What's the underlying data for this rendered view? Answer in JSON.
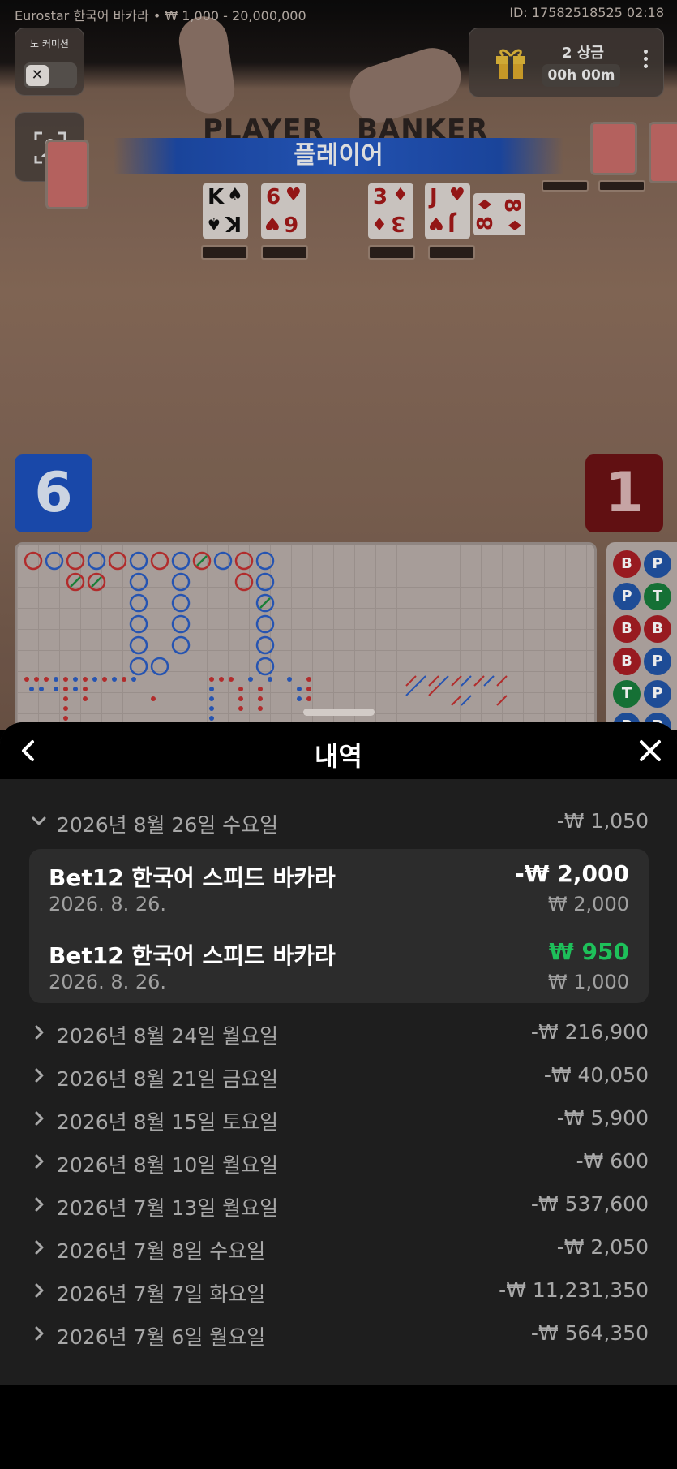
{
  "game": {
    "title_left": "Eurostar 한국어 바카라 • ₩ 1,000 - 20,000,000",
    "title_right": "ID: 17582518525 02:18",
    "commission_label": "노 커미션",
    "commission_toggle_icon": "close-icon",
    "camera_icon": "person-focus-icon",
    "prizes": {
      "count_label": "2 상금",
      "timer": "00h 00m",
      "icon": "gift-icon"
    },
    "table_player_label": "PLAYER",
    "table_banker_label": "BANKER",
    "result_banner": "플레이어",
    "player_cards": [
      {
        "rank": "K",
        "suit": "♠",
        "color": "black"
      },
      {
        "rank": "6",
        "suit": "♥",
        "color": "red"
      }
    ],
    "banker_cards": [
      {
        "rank": "3",
        "suit": "♦",
        "color": "red"
      },
      {
        "rank": "J",
        "suit": "♥",
        "color": "red"
      },
      {
        "rank": "8",
        "suit": "♦",
        "color": "red"
      }
    ],
    "player_score": "6",
    "banker_score": "1",
    "bead_road": [
      [
        "B",
        "P"
      ],
      [
        "P",
        "T"
      ],
      [
        "B",
        "B"
      ],
      [
        "B",
        "P"
      ],
      [
        "T",
        "P"
      ],
      [
        "P",
        "P"
      ]
    ]
  },
  "history": {
    "title": "내역",
    "back_icon": "chevron-left-icon",
    "close_icon": "close-icon",
    "expanded_day": {
      "date": "2026년 8월 26일 수요일",
      "total": "-₩ 1,050"
    },
    "bets": [
      {
        "game": "Bet12 한국어 스피드 바카라",
        "date": "2026. 8. 26.",
        "result": "-₩ 2,000",
        "stake": "₩ 2,000",
        "win": false
      },
      {
        "game": "Bet12 한국어 스피드 바카라",
        "date": "2026. 8. 26.",
        "result": "₩ 950",
        "stake": "₩ 1,000",
        "win": true
      }
    ],
    "days": [
      {
        "date": "2026년 8월 24일 월요일",
        "total": "-₩ 216,900"
      },
      {
        "date": "2026년 8월 21일 금요일",
        "total": "-₩ 40,050"
      },
      {
        "date": "2026년 8월 15일 토요일",
        "total": "-₩ 5,900"
      },
      {
        "date": "2026년 8월 10일 월요일",
        "total": "-₩ 600"
      },
      {
        "date": "2026년 7월 13일 월요일",
        "total": "-₩ 537,600"
      },
      {
        "date": "2026년 7월 8일 수요일",
        "total": "-₩ 2,050"
      },
      {
        "date": "2026년 7월 7일 화요일",
        "total": "-₩ 11,231,350"
      },
      {
        "date": "2026년 7월 6일 월요일",
        "total": "-₩ 564,350"
      }
    ],
    "colors": {
      "win": "#1ec05a",
      "loss": "#ffffff",
      "muted": "#a8a8a8"
    }
  }
}
